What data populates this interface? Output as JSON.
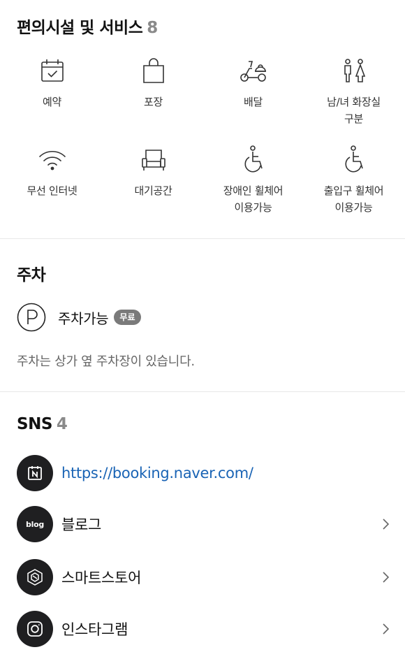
{
  "amenities": {
    "title": "편의시설 및 서비스",
    "count": "8",
    "items": [
      {
        "label": "예약",
        "icon": "calendar-check-icon"
      },
      {
        "label": "포장",
        "icon": "shopping-bag-icon"
      },
      {
        "label": "배달",
        "icon": "delivery-scooter-icon"
      },
      {
        "label": "남/녀 화장실\n구분",
        "icon": "restroom-icon"
      },
      {
        "label": "무선 인터넷",
        "icon": "wifi-icon"
      },
      {
        "label": "대기공간",
        "icon": "armchair-icon"
      },
      {
        "label": "장애인 휠체어\n이용가능",
        "icon": "wheelchair-icon"
      },
      {
        "label": "출입구 휠체어\n이용가능",
        "icon": "wheelchair-entrance-icon"
      }
    ]
  },
  "parking": {
    "title": "주차",
    "status": "주차가능",
    "badge": "무료",
    "note": "주차는 상가 옆 주차장이 있습니다."
  },
  "sns": {
    "title": "SNS",
    "count": "4",
    "items": [
      {
        "label": "https://booking.naver.com/",
        "icon": "naver-booking-icon",
        "is_link": true
      },
      {
        "label": "블로그",
        "icon": "blog-icon",
        "icon_text": "blog"
      },
      {
        "label": "스마트스토어",
        "icon": "smartstore-icon"
      },
      {
        "label": "인스타그램",
        "icon": "instagram-icon"
      }
    ]
  },
  "colors": {
    "text": "#111111",
    "muted": "#8a8a8a",
    "link": "#1a64b5",
    "icon_circle": "#1f1f21",
    "badge": "#7a7a7a"
  }
}
